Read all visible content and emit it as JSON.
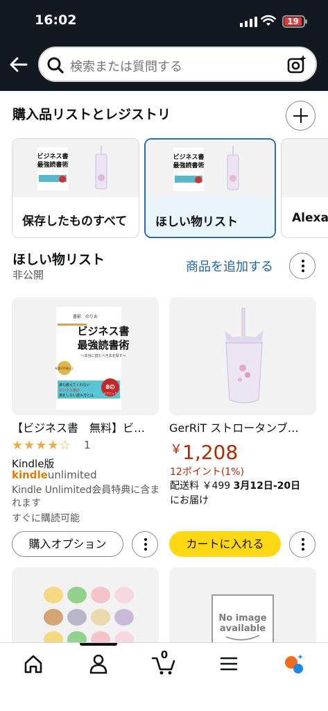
{
  "status_bar": {
    "time": "16:02",
    "battery": "19"
  },
  "search": {
    "placeholder": "検索または質問する"
  },
  "lists_section": {
    "title": "購入品リストとレジストリ",
    "cards": [
      {
        "label": "保存したものすべて"
      },
      {
        "label": "ほしい物リスト"
      },
      {
        "label": "Alexa"
      }
    ]
  },
  "wishlist": {
    "title": "ほしい物リスト",
    "privacy": "非公開",
    "add_items": "商品を追加する"
  },
  "products": [
    {
      "title": "【ビジネス書　無料】ビ…",
      "rating_stars": "★★★★☆",
      "rating_count": "1",
      "format": "Kindle版",
      "ku_brand_kindle": "kindle",
      "ku_brand_unlimited": "unlimited",
      "ku_note": "Kindle Unlimited会員特典に含まれます",
      "instant": "すぐに購読可能",
      "button": "購入オプション",
      "cover": {
        "author": "書影　のりお",
        "line1": "ビジネス書",
        "line2": "最強読書術",
        "subtitle": "〜本当に読むべき本を探す〜",
        "band1": "誰も教えてくれない",
        "band2": "ビジネス書の",
        "band3": "損をしない読み方とは",
        "seal": "8の",
        "seal2": "テクニック",
        "badge": "年間150冊以上"
      }
    },
    {
      "title": "GerRiT ストロータンブ…",
      "price_yen": "￥",
      "price": "1,208",
      "points": "12ポイント(1%)",
      "ship_prefix": "配送料 ￥499 ",
      "ship_date": "3月12日-20日",
      "ship_suffix": "にお届け",
      "button": "カートに入れる"
    },
    {
      "title": ""
    },
    {
      "no_image_line1": "No image",
      "no_image_line2": "available"
    }
  ],
  "bottom_nav": {
    "cart_count": "0",
    "items": [
      "home",
      "account",
      "cart",
      "menu",
      "rufus"
    ]
  },
  "colors": {
    "header_bg": "#131921",
    "link": "#2162a1",
    "price": "#b12704",
    "cart_button": "#ffd814",
    "star": "#f3a847",
    "ku_orange": "#e07b00"
  }
}
